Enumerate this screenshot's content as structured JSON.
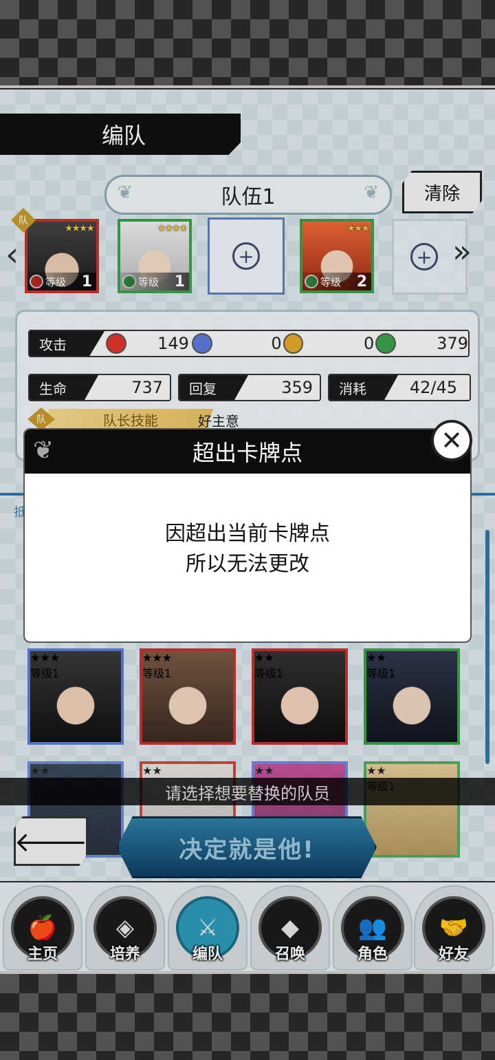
{
  "header": {
    "title": "编队"
  },
  "team": {
    "name": "队伍1",
    "clear_label": "清除",
    "leader_badge": "队",
    "slots": [
      {
        "type": "card",
        "stars": "★★★★",
        "level_label": "等级",
        "level": "1",
        "element": "fire"
      },
      {
        "type": "card",
        "stars": "★★★★",
        "level_label": "等级",
        "level": "1",
        "element": "wind"
      },
      {
        "type": "empty",
        "plus": "+"
      },
      {
        "type": "card",
        "stars": "★★★",
        "level_label": "等级",
        "level": "2",
        "element": "wind"
      },
      {
        "type": "empty",
        "plus": "+"
      }
    ],
    "prev_icon": "‹",
    "next_icon": "»"
  },
  "stats": {
    "attack_label": "攻击",
    "attack_values": [
      "149",
      "0",
      "0",
      "379"
    ],
    "hp_label": "生命",
    "hp_value": "737",
    "heal_label": "回复",
    "heal_value": "359",
    "cost_label": "消耗",
    "cost_value": "42/45",
    "leader_skill_label": "队长技能",
    "leader_skill_value": "好主意"
  },
  "modal": {
    "title": "超出卡牌点",
    "line1": "因超出当前卡牌点",
    "line2": "所以无法更改",
    "close_icon": "✕"
  },
  "grid_cards": [
    {
      "stars": "★★★",
      "level_label": "等级",
      "level": "1",
      "element": "ice"
    },
    {
      "stars": "★★★",
      "level_label": "等级",
      "level": "1",
      "element": "fire"
    },
    {
      "stars": "★★",
      "level_label": "等级",
      "level": "1",
      "element": "fire"
    },
    {
      "stars": "★★",
      "level_label": "等级",
      "level": "1",
      "element": "wind"
    }
  ],
  "grid_row2": [
    {
      "stars": "★★"
    },
    {
      "stars": "★★"
    },
    {
      "stars": "★★"
    },
    {
      "stars": "★★",
      "level_label": "等级",
      "level": "1"
    }
  ],
  "instruction": "请选择想要替换的队员",
  "back_icon": "🡐",
  "decide_label": "决定就是他!",
  "nav": [
    {
      "label": "主页",
      "icon": "🍎"
    },
    {
      "label": "培养",
      "icon": "◈"
    },
    {
      "label": "编队",
      "icon": "⚔"
    },
    {
      "label": "召唤",
      "icon": "◆"
    },
    {
      "label": "角色",
      "icon": "👥"
    },
    {
      "label": "好友",
      "icon": "🤝"
    }
  ],
  "colors": {
    "fire": "#e2332d",
    "wind": "#3aa14a",
    "ice": "#5b7bd8",
    "gold": "#e3a92a"
  }
}
